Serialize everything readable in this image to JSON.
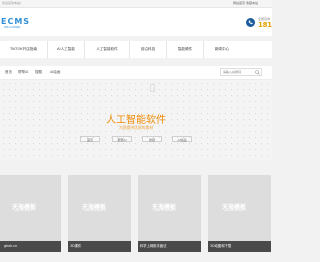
{
  "topbar": {
    "welcome": "欢迎来到本站!",
    "links": "网站首页  收藏本站"
  },
  "header": {
    "logo_mark": "ECMS",
    "logo_tag": "帝国CMS网站模板",
    "hotline_label": "全国咨询",
    "hotline_number": "181",
    "accent": "#ef8a00",
    "brand": "#2f8fd6"
  },
  "nav": {
    "items": [
      "TIKTOK开店指南",
      "AI人工智能",
      "人工智能软件",
      "前沿科技",
      "智能硬件",
      "新闻中心"
    ]
  },
  "subnav": {
    "items": [
      "首页",
      "帮帮AI",
      "搜题",
      "AI绘画"
    ],
    "search_placeholder": "请输入关键词"
  },
  "hero": {
    "title": "人工智能软件",
    "subtitle": "为您提供优质的素材",
    "chips": [
      "首页",
      "帮帮AI",
      "搜题",
      "AI绘画"
    ]
  },
  "cards": [
    {
      "caption": "ghxh.cn",
      "watermark": "天海模板",
      "watermark_sub": "www.thinkphp.cn"
    },
    {
      "caption": "3D课件",
      "watermark": "天海模板",
      "watermark_sub": "www.thinkphp.cn"
    },
    {
      "caption": "科学上网助手魔法",
      "watermark": "天海模板",
      "watermark_sub": "www.thinkphp.cn"
    },
    {
      "caption": "3D动图和下载",
      "watermark": "天海模板",
      "watermark_sub": "www.thinkphp.cn"
    }
  ]
}
